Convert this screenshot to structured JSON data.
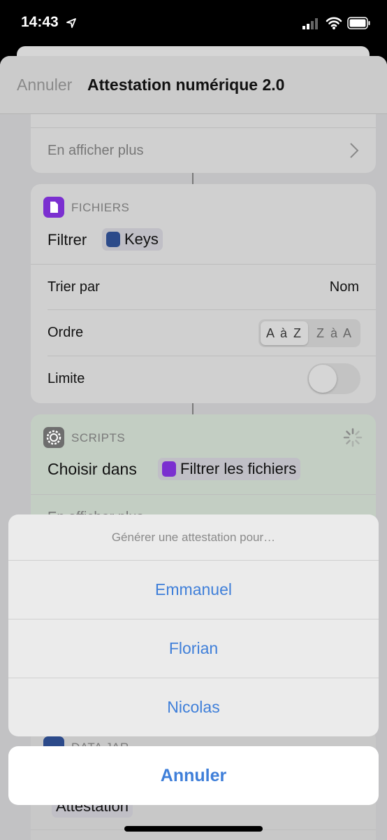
{
  "status_bar": {
    "time": "14:43",
    "location_icon": "location-arrow-icon",
    "signal_icon": "cellular-signal-icon",
    "wifi_icon": "wifi-icon",
    "battery_icon": "battery-icon"
  },
  "nav": {
    "cancel": "Annuler",
    "title": "Attestation numérique 2.0"
  },
  "card_top": {
    "show_more": "En afficher plus"
  },
  "files_card": {
    "header": "FICHIERS",
    "action": "Filtrer",
    "chip": "Keys",
    "sort_label": "Trier par",
    "sort_value": "Nom",
    "order_label": "Ordre",
    "order_options": [
      "A à Z",
      "Z à A"
    ],
    "order_selected": "A à Z",
    "limit_label": "Limite",
    "limit_on": false,
    "accent": "#7b2fd0"
  },
  "scripts_card": {
    "header": "SCRIPTS",
    "action": "Choisir dans",
    "chip": "Filtrer les fichiers",
    "show_more": "En afficher plus"
  },
  "datajar_card": {
    "header": "DATA JAR",
    "chip": "Attestation"
  },
  "action_sheet": {
    "title": "Générer une attestation pour…",
    "options": [
      "Emmanuel",
      "Florian",
      "Nicolas"
    ],
    "cancel": "Annuler",
    "accent": "#3f7fd9"
  }
}
